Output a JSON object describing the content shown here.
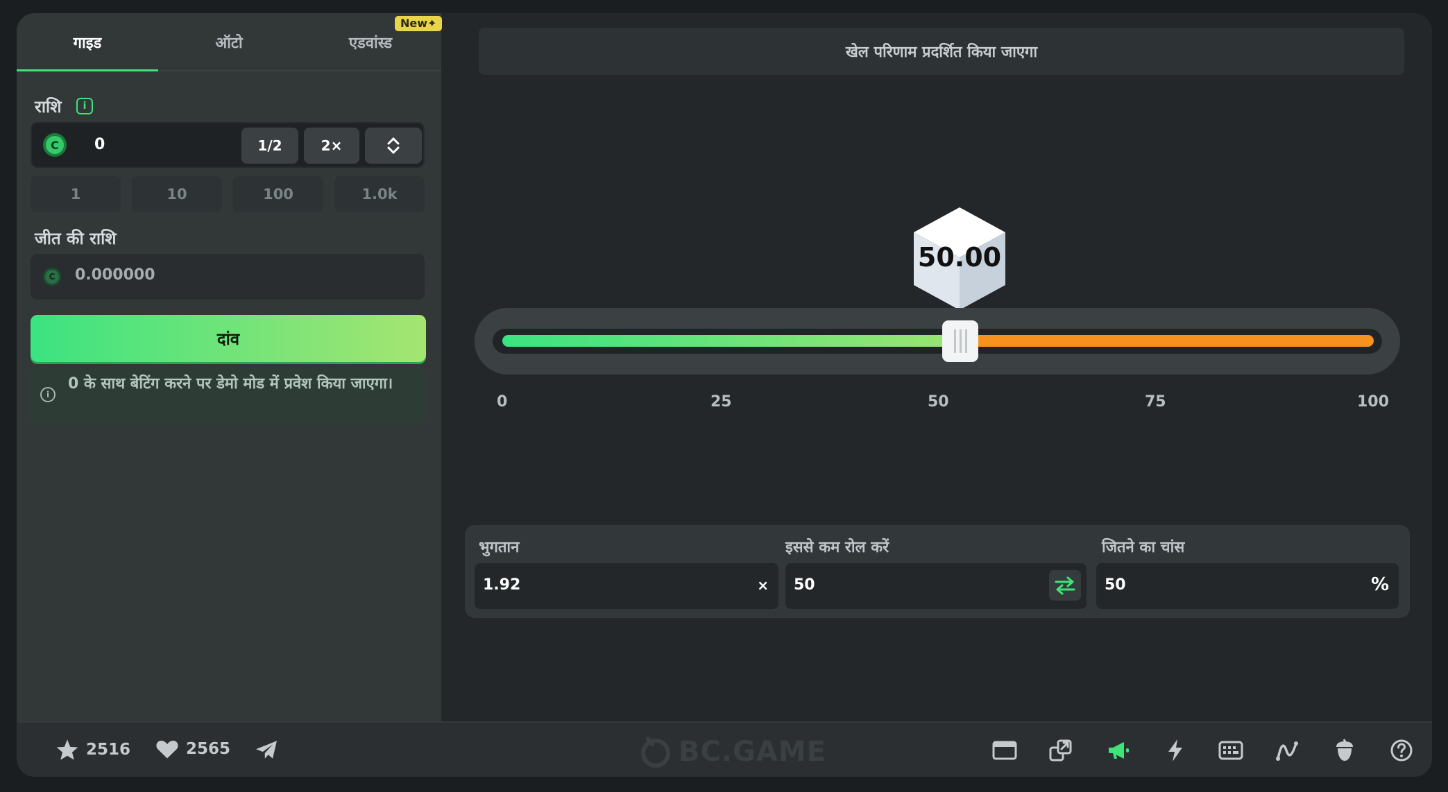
{
  "tabs": {
    "manual": "गाइड",
    "auto": "ऑटो",
    "advanced": "एडवांस्ड",
    "new_badge": "New"
  },
  "bet": {
    "amount_label": "राशि",
    "amount_value": "0",
    "half_label": "1/2",
    "double_label": "2×",
    "quick_amounts": [
      "1",
      "10",
      "100",
      "1.0k"
    ],
    "win_label": "जीत की राशि",
    "win_value": "0.000000",
    "bet_button": "दांव",
    "demo_notice": "0 के साथ बेटिंग करने पर डेमो मोड में प्रवेश किया जाएगा।"
  },
  "game": {
    "result_placeholder": "खेल परिणाम प्रदर्शित किया जाएगा",
    "dice_value": "50.00",
    "slider_value": 50,
    "ticks": [
      "0",
      "25",
      "50",
      "75",
      "100"
    ],
    "payout_label": "भुगतान",
    "payout_value": "1.92",
    "payout_suffix": "×",
    "roll_label": "इससे कम रोल करें",
    "roll_value": "50",
    "chance_label": "जितने का चांस",
    "chance_value": "50",
    "chance_suffix": "%"
  },
  "footer": {
    "stars": "2516",
    "likes": "2565",
    "logo": "BC.GAME",
    "icons": [
      "window-icon",
      "popout-icon",
      "sound-icon",
      "lightning-icon",
      "keyboard-icon",
      "chart-icon",
      "acorn-icon",
      "help-icon"
    ]
  },
  "colors": {
    "accent_green": "#3fe37a",
    "orange": "#f7921f",
    "badge_yellow": "#e9d44a"
  }
}
